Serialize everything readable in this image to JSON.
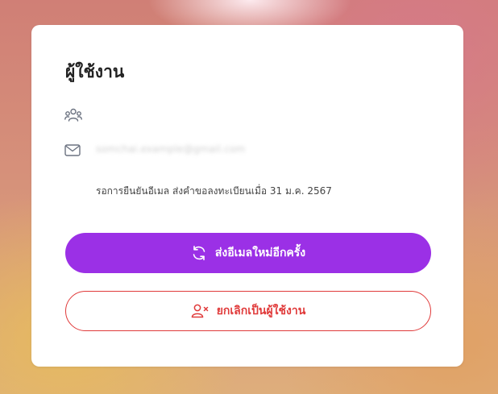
{
  "card": {
    "title": "ผู้ใช้งาน",
    "email": "somchai.example@gmail.com",
    "status": "รอการยืนยันอีเมล ส่งคำขอลงทะเบียนเมื่อ 31 ม.ค. 2567"
  },
  "actions": {
    "resend_label": "ส่งอีเมลใหม่อีกครั้ง",
    "cancel_label": "ยกเลิกเป็นผู้ใช้งาน"
  },
  "icons": {
    "users": "users-icon",
    "mail": "mail-icon",
    "refresh": "refresh-icon",
    "remove_user": "user-remove-icon"
  },
  "colors": {
    "primary": "#9b30e6",
    "danger": "#e03a3a",
    "icon_gray": "#6b7280"
  }
}
